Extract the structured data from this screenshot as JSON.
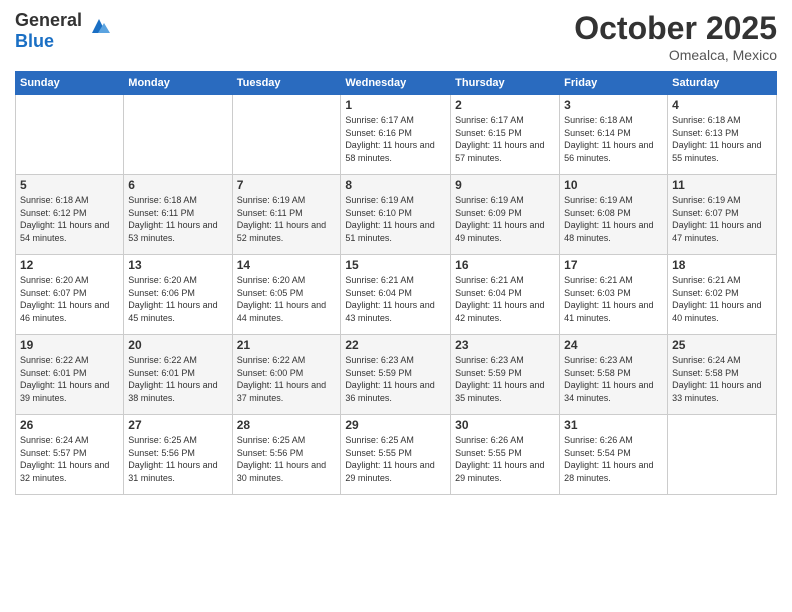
{
  "header": {
    "logo_general": "General",
    "logo_blue": "Blue",
    "month": "October 2025",
    "location": "Omealca, Mexico"
  },
  "weekdays": [
    "Sunday",
    "Monday",
    "Tuesday",
    "Wednesday",
    "Thursday",
    "Friday",
    "Saturday"
  ],
  "weeks": [
    [
      {
        "day": "",
        "sunrise": "",
        "sunset": "",
        "daylight": ""
      },
      {
        "day": "",
        "sunrise": "",
        "sunset": "",
        "daylight": ""
      },
      {
        "day": "",
        "sunrise": "",
        "sunset": "",
        "daylight": ""
      },
      {
        "day": "1",
        "sunrise": "Sunrise: 6:17 AM",
        "sunset": "Sunset: 6:16 PM",
        "daylight": "Daylight: 11 hours and 58 minutes."
      },
      {
        "day": "2",
        "sunrise": "Sunrise: 6:17 AM",
        "sunset": "Sunset: 6:15 PM",
        "daylight": "Daylight: 11 hours and 57 minutes."
      },
      {
        "day": "3",
        "sunrise": "Sunrise: 6:18 AM",
        "sunset": "Sunset: 6:14 PM",
        "daylight": "Daylight: 11 hours and 56 minutes."
      },
      {
        "day": "4",
        "sunrise": "Sunrise: 6:18 AM",
        "sunset": "Sunset: 6:13 PM",
        "daylight": "Daylight: 11 hours and 55 minutes."
      }
    ],
    [
      {
        "day": "5",
        "sunrise": "Sunrise: 6:18 AM",
        "sunset": "Sunset: 6:12 PM",
        "daylight": "Daylight: 11 hours and 54 minutes."
      },
      {
        "day": "6",
        "sunrise": "Sunrise: 6:18 AM",
        "sunset": "Sunset: 6:11 PM",
        "daylight": "Daylight: 11 hours and 53 minutes."
      },
      {
        "day": "7",
        "sunrise": "Sunrise: 6:19 AM",
        "sunset": "Sunset: 6:11 PM",
        "daylight": "Daylight: 11 hours and 52 minutes."
      },
      {
        "day": "8",
        "sunrise": "Sunrise: 6:19 AM",
        "sunset": "Sunset: 6:10 PM",
        "daylight": "Daylight: 11 hours and 51 minutes."
      },
      {
        "day": "9",
        "sunrise": "Sunrise: 6:19 AM",
        "sunset": "Sunset: 6:09 PM",
        "daylight": "Daylight: 11 hours and 49 minutes."
      },
      {
        "day": "10",
        "sunrise": "Sunrise: 6:19 AM",
        "sunset": "Sunset: 6:08 PM",
        "daylight": "Daylight: 11 hours and 48 minutes."
      },
      {
        "day": "11",
        "sunrise": "Sunrise: 6:19 AM",
        "sunset": "Sunset: 6:07 PM",
        "daylight": "Daylight: 11 hours and 47 minutes."
      }
    ],
    [
      {
        "day": "12",
        "sunrise": "Sunrise: 6:20 AM",
        "sunset": "Sunset: 6:07 PM",
        "daylight": "Daylight: 11 hours and 46 minutes."
      },
      {
        "day": "13",
        "sunrise": "Sunrise: 6:20 AM",
        "sunset": "Sunset: 6:06 PM",
        "daylight": "Daylight: 11 hours and 45 minutes."
      },
      {
        "day": "14",
        "sunrise": "Sunrise: 6:20 AM",
        "sunset": "Sunset: 6:05 PM",
        "daylight": "Daylight: 11 hours and 44 minutes."
      },
      {
        "day": "15",
        "sunrise": "Sunrise: 6:21 AM",
        "sunset": "Sunset: 6:04 PM",
        "daylight": "Daylight: 11 hours and 43 minutes."
      },
      {
        "day": "16",
        "sunrise": "Sunrise: 6:21 AM",
        "sunset": "Sunset: 6:04 PM",
        "daylight": "Daylight: 11 hours and 42 minutes."
      },
      {
        "day": "17",
        "sunrise": "Sunrise: 6:21 AM",
        "sunset": "Sunset: 6:03 PM",
        "daylight": "Daylight: 11 hours and 41 minutes."
      },
      {
        "day": "18",
        "sunrise": "Sunrise: 6:21 AM",
        "sunset": "Sunset: 6:02 PM",
        "daylight": "Daylight: 11 hours and 40 minutes."
      }
    ],
    [
      {
        "day": "19",
        "sunrise": "Sunrise: 6:22 AM",
        "sunset": "Sunset: 6:01 PM",
        "daylight": "Daylight: 11 hours and 39 minutes."
      },
      {
        "day": "20",
        "sunrise": "Sunrise: 6:22 AM",
        "sunset": "Sunset: 6:01 PM",
        "daylight": "Daylight: 11 hours and 38 minutes."
      },
      {
        "day": "21",
        "sunrise": "Sunrise: 6:22 AM",
        "sunset": "Sunset: 6:00 PM",
        "daylight": "Daylight: 11 hours and 37 minutes."
      },
      {
        "day": "22",
        "sunrise": "Sunrise: 6:23 AM",
        "sunset": "Sunset: 5:59 PM",
        "daylight": "Daylight: 11 hours and 36 minutes."
      },
      {
        "day": "23",
        "sunrise": "Sunrise: 6:23 AM",
        "sunset": "Sunset: 5:59 PM",
        "daylight": "Daylight: 11 hours and 35 minutes."
      },
      {
        "day": "24",
        "sunrise": "Sunrise: 6:23 AM",
        "sunset": "Sunset: 5:58 PM",
        "daylight": "Daylight: 11 hours and 34 minutes."
      },
      {
        "day": "25",
        "sunrise": "Sunrise: 6:24 AM",
        "sunset": "Sunset: 5:58 PM",
        "daylight": "Daylight: 11 hours and 33 minutes."
      }
    ],
    [
      {
        "day": "26",
        "sunrise": "Sunrise: 6:24 AM",
        "sunset": "Sunset: 5:57 PM",
        "daylight": "Daylight: 11 hours and 32 minutes."
      },
      {
        "day": "27",
        "sunrise": "Sunrise: 6:25 AM",
        "sunset": "Sunset: 5:56 PM",
        "daylight": "Daylight: 11 hours and 31 minutes."
      },
      {
        "day": "28",
        "sunrise": "Sunrise: 6:25 AM",
        "sunset": "Sunset: 5:56 PM",
        "daylight": "Daylight: 11 hours and 30 minutes."
      },
      {
        "day": "29",
        "sunrise": "Sunrise: 6:25 AM",
        "sunset": "Sunset: 5:55 PM",
        "daylight": "Daylight: 11 hours and 29 minutes."
      },
      {
        "day": "30",
        "sunrise": "Sunrise: 6:26 AM",
        "sunset": "Sunset: 5:55 PM",
        "daylight": "Daylight: 11 hours and 29 minutes."
      },
      {
        "day": "31",
        "sunrise": "Sunrise: 6:26 AM",
        "sunset": "Sunset: 5:54 PM",
        "daylight": "Daylight: 11 hours and 28 minutes."
      },
      {
        "day": "",
        "sunrise": "",
        "sunset": "",
        "daylight": ""
      }
    ]
  ]
}
